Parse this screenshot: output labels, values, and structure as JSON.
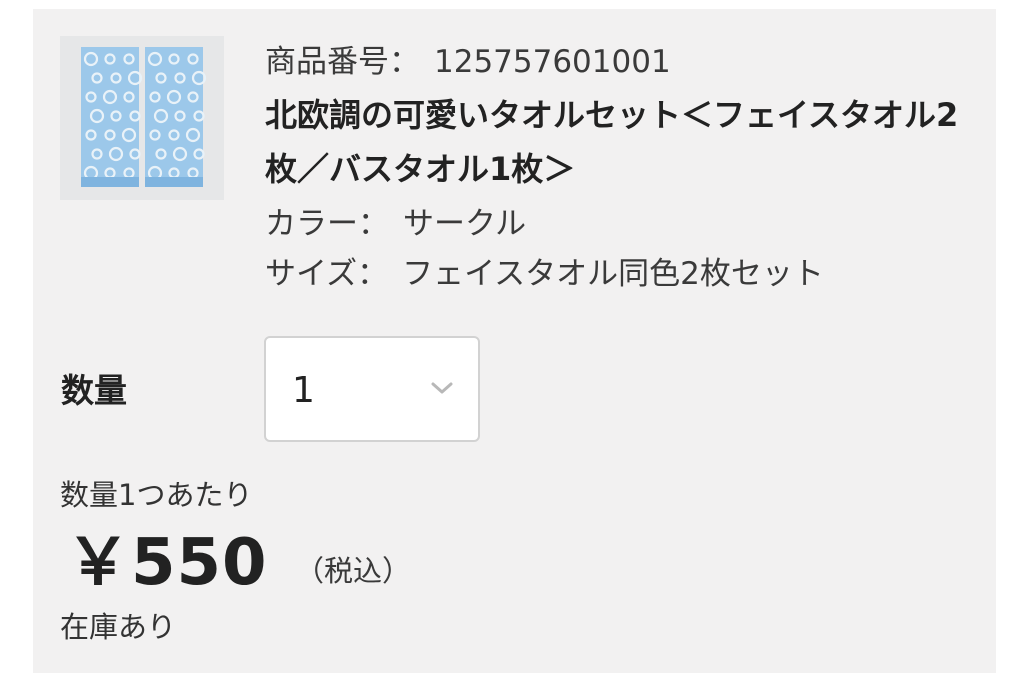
{
  "product": {
    "number_label": "商品番号：",
    "number_value": "125757601001",
    "title": "北欧調の可愛いタオルセット＜フェイスタオル2枚／バスタオル1枚＞",
    "color_label": "カラー：",
    "color_value": "サークル",
    "size_label": "サイズ：",
    "size_value": "フェイスタオル同色2枚セット",
    "image_icon": "product-thumbnail-image"
  },
  "quantity": {
    "label": "数量",
    "selected": "1",
    "dropdown_icon": "chevron-down-icon"
  },
  "pricing": {
    "per_unit_label": "数量1つあたり",
    "price": "￥550",
    "tax_note": "（税込）",
    "stock_status": "在庫あり"
  },
  "colors": {
    "panel_bg": "#f2f1f1",
    "towel_blue": "#9cc8ea",
    "towel_pattern": "#e9f2f8"
  }
}
